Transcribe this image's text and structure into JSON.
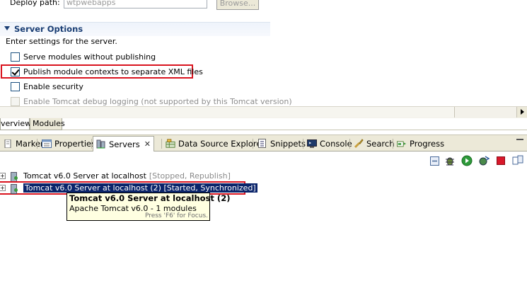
{
  "deploy": {
    "label": "Deploy path:",
    "value": "wtpwebapps",
    "browse_label": "Browse..."
  },
  "server_options": {
    "title": "Server Options",
    "description": "Enter settings for the server.",
    "options": [
      {
        "label": "Serve modules without publishing",
        "checked": false,
        "enabled": true
      },
      {
        "label": "Publish module contexts to separate XML files",
        "checked": true,
        "enabled": true
      },
      {
        "label": "Enable security",
        "checked": false,
        "enabled": true
      },
      {
        "label": "Enable Tomcat debug logging (not supported by this Tomcat version)",
        "checked": false,
        "enabled": false
      }
    ]
  },
  "editor_tabs": [
    "verview",
    "Modules"
  ],
  "view_tabs": [
    "Markers",
    "Properties",
    "Servers",
    "Data Source Explorer",
    "Snippets",
    "Console",
    "Search",
    "Progress"
  ],
  "servers": [
    {
      "name": "Tomcat v6.0 Server at localhost",
      "status": "[Stopped, Republish]"
    },
    {
      "name": "Tomcat v6.0 Server at localhost (2)",
      "status": "[Started, Synchronized]"
    }
  ],
  "tooltip": {
    "title": "Tomcat v6.0 Server at localhost (2)",
    "line": "Apache Tomcat v6.0 - 1 modules",
    "hint": "Press 'F6' for Focus."
  },
  "colors": {
    "highlight": "#d9141f",
    "section_title": "#1a3e74",
    "selection": "#0a246a",
    "tooltip_bg": "#ffffe1"
  }
}
